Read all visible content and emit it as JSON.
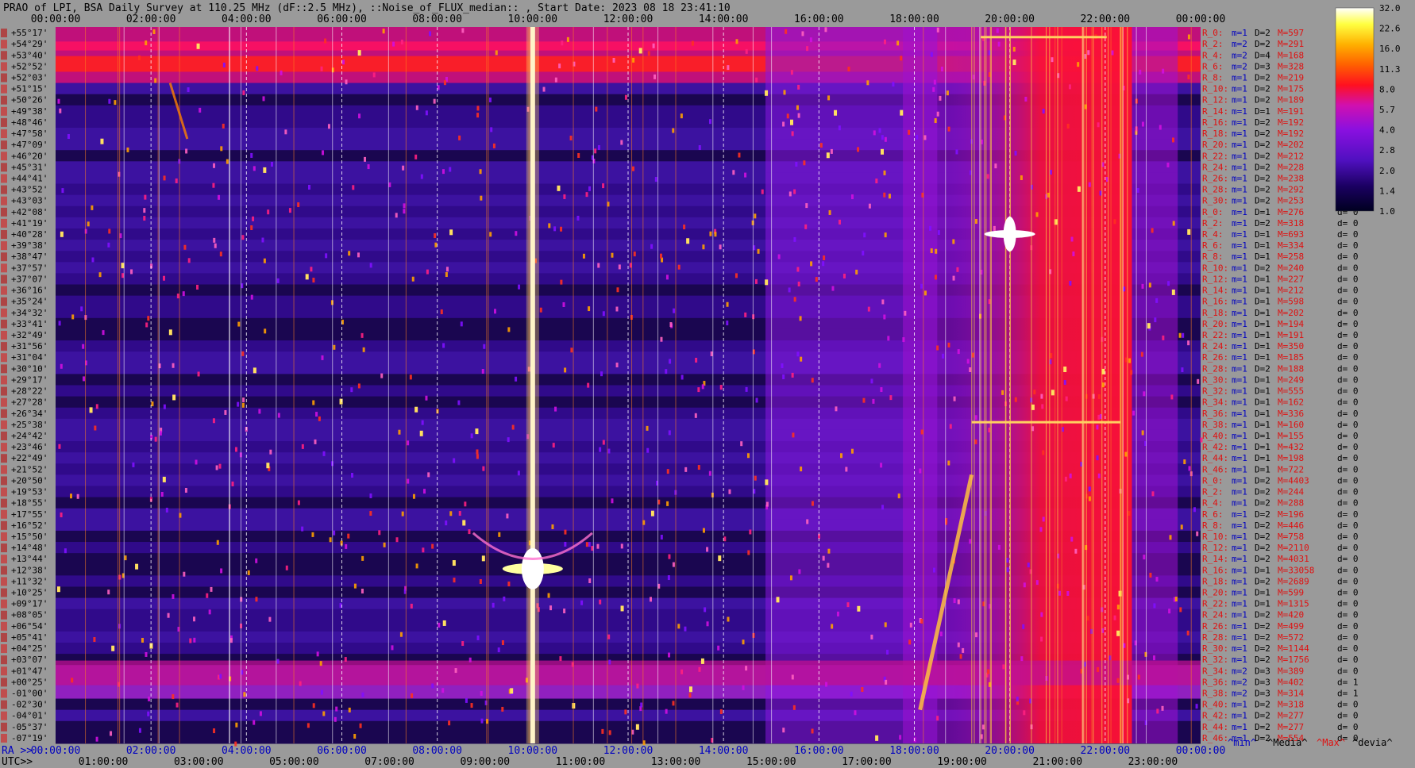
{
  "title": "PRAO of LPI, BSA Daily Survey at 110.25 MHz (dF::2.5 MHz), ::Noise_of_FLUX_median:: , Start Date: 2023 08 18 23:41:10",
  "ra_prefix": "RA >>",
  "utc_prefix": "UTC>>",
  "colorbar": {
    "ticks": [
      "32.0",
      "22.6",
      "16.0",
      "11.3",
      "8.0",
      "5.7",
      "4.0",
      "2.8",
      "2.0",
      "1.4",
      "1.0"
    ]
  },
  "chart_data": {
    "type": "heatmap",
    "title": "PRAO of LPI, BSA Daily Survey at 110.25 MHz (dF::2.5 MHz), ::Noise_of_FLUX_median:: , Start Date: 2023 08 18 23:41:10",
    "x_top_ticks": [
      "00:00:00",
      "02:00:00",
      "04:00:00",
      "06:00:00",
      "08:00:00",
      "10:00:00",
      "12:00:00",
      "14:00:00",
      "16:00:00",
      "18:00:00",
      "20:00:00",
      "22:00:00",
      "00:00:00"
    ],
    "x_ra_ticks": [
      "00:00:00",
      "02:00:00",
      "04:00:00",
      "06:00:00",
      "08:00:00",
      "10:00:00",
      "12:00:00",
      "14:00:00",
      "16:00:00",
      "18:00:00",
      "20:00:00",
      "22:00:00",
      "00:00:00"
    ],
    "x_utc_ticks": [
      "01:00:00",
      "03:00:00",
      "05:00:00",
      "07:00:00",
      "09:00:00",
      "11:00:00",
      "13:00:00",
      "15:00:00",
      "17:00:00",
      "19:00:00",
      "21:00:00",
      "23:00:00"
    ],
    "y_ticks": [
      "+55°17'",
      "+54°29'",
      "+53°40'",
      "+52°52'",
      "+52°03'",
      "+51°15'",
      "+50°26'",
      "+49°38'",
      "+48°46'",
      "+47°58'",
      "+47°09'",
      "+46°20'",
      "+45°31'",
      "+44°41'",
      "+43°52'",
      "+43°03'",
      "+42°08'",
      "+41°19'",
      "+40°28'",
      "+39°38'",
      "+38°47'",
      "+37°57'",
      "+37°07'",
      "+36°16'",
      "+35°24'",
      "+34°32'",
      "+33°41'",
      "+32°49'",
      "+31°56'",
      "+31°04'",
      "+30°10'",
      "+29°17'",
      "+28°22'",
      "+27°28'",
      "+26°34'",
      "+25°38'",
      "+24°42'",
      "+23°46'",
      "+22°49'",
      "+21°52'",
      "+20°50'",
      "+19°53'",
      "+18°55'",
      "+17°55'",
      "+16°52'",
      "+15°50'",
      "+14°48'",
      "+13°44'",
      "+12°38'",
      "+11°32'",
      "+10°25'",
      "+09°17'",
      "+08°05'",
      "+06°54'",
      "+05°41'",
      "+04°25'",
      "+03°07'",
      "+01°47'",
      "+00°25'",
      "-01°00'",
      "-02°30'",
      "-04°01'",
      "-05°37'",
      "-07°19'"
    ],
    "colorbar_range": [
      1.0,
      32.0
    ],
    "colorbar_scale": "log"
  },
  "right_panel": {
    "rows": [
      {
        "r": "R_0:",
        "m": "m=1",
        "d": "D=2",
        "M": "M=597",
        "dv": "d= 0"
      },
      {
        "r": "R_2:",
        "m": "m=2",
        "d": "D=2",
        "M": "M=291",
        "dv": "d= 0"
      },
      {
        "r": "R_4:",
        "m": "m=2",
        "d": "D=4",
        "M": "M=168",
        "dv": "d= 1"
      },
      {
        "r": "R_6:",
        "m": "m=2",
        "d": "D=3",
        "M": "M=328",
        "dv": "d= 0"
      },
      {
        "r": "R_8:",
        "m": "m=1",
        "d": "D=2",
        "M": "M=219",
        "dv": "d= 0"
      },
      {
        "r": "R_10:",
        "m": "m=1",
        "d": "D=2",
        "M": "M=175",
        "dv": "d="
      },
      {
        "r": "R_12:",
        "m": "m=1",
        "d": "D=2",
        "M": "M=189",
        "dv": "d="
      },
      {
        "r": "R_14:",
        "m": "m=1",
        "d": "D=1",
        "M": "M=191",
        "dv": "d="
      },
      {
        "r": "R_16:",
        "m": "m=1",
        "d": "D=2",
        "M": "M=192",
        "dv": "d="
      },
      {
        "r": "R_18:",
        "m": "m=1",
        "d": "D=2",
        "M": "M=192",
        "dv": "d="
      },
      {
        "r": "R_20:",
        "m": "m=1",
        "d": "D=2",
        "M": "M=202",
        "dv": "d="
      },
      {
        "r": "R_22:",
        "m": "m=1",
        "d": "D=2",
        "M": "M=212",
        "dv": "d="
      },
      {
        "r": "R_24:",
        "m": "m=1",
        "d": "D=2",
        "M": "M=228",
        "dv": "d="
      },
      {
        "r": "R_26:",
        "m": "m=1",
        "d": "D=2",
        "M": "M=238",
        "dv": "d="
      },
      {
        "r": "R_28:",
        "m": "m=1",
        "d": "D=2",
        "M": "M=292",
        "dv": "d="
      },
      {
        "r": "R_30:",
        "m": "m=1",
        "d": "D=2",
        "M": "M=253",
        "dv": "d="
      },
      {
        "r": "R_0:",
        "m": "m=1",
        "d": "D=1",
        "M": "M=276",
        "dv": "d= 0"
      },
      {
        "r": "R_2:",
        "m": "m=1",
        "d": "D=2",
        "M": "M=318",
        "dv": "d= 0"
      },
      {
        "r": "R_4:",
        "m": "m=1",
        "d": "D=1",
        "M": "M=693",
        "dv": "d= 0"
      },
      {
        "r": "R_6:",
        "m": "m=1",
        "d": "D=1",
        "M": "M=334",
        "dv": "d= 0"
      },
      {
        "r": "R_8:",
        "m": "m=1",
        "d": "D=1",
        "M": "M=258",
        "dv": "d= 0"
      },
      {
        "r": "R_10:",
        "m": "m=1",
        "d": "D=2",
        "M": "M=240",
        "dv": "d= 0"
      },
      {
        "r": "R_12:",
        "m": "m=1",
        "d": "D=1",
        "M": "M=227",
        "dv": "d= 0"
      },
      {
        "r": "R_14:",
        "m": "m=1",
        "d": "D=1",
        "M": "M=212",
        "dv": "d= 0"
      },
      {
        "r": "R_16:",
        "m": "m=1",
        "d": "D=1",
        "M": "M=598",
        "dv": "d= 0"
      },
      {
        "r": "R_18:",
        "m": "m=1",
        "d": "D=1",
        "M": "M=202",
        "dv": "d= 0"
      },
      {
        "r": "R_20:",
        "m": "m=1",
        "d": "D=1",
        "M": "M=194",
        "dv": "d= 0"
      },
      {
        "r": "R_22:",
        "m": "m=1",
        "d": "D=1",
        "M": "M=191",
        "dv": "d= 0"
      },
      {
        "r": "R_24:",
        "m": "m=1",
        "d": "D=1",
        "M": "M=350",
        "dv": "d= 0"
      },
      {
        "r": "R_26:",
        "m": "m=1",
        "d": "D=1",
        "M": "M=185",
        "dv": "d= 0"
      },
      {
        "r": "R_28:",
        "m": "m=1",
        "d": "D=2",
        "M": "M=188",
        "dv": "d= 0"
      },
      {
        "r": "R_30:",
        "m": "m=1",
        "d": "D=1",
        "M": "M=249",
        "dv": "d= 0"
      },
      {
        "r": "R_32:",
        "m": "m=1",
        "d": "D=1",
        "M": "M=555",
        "dv": "d= 0"
      },
      {
        "r": "R_34:",
        "m": "m=1",
        "d": "D=1",
        "M": "M=162",
        "dv": "d= 0"
      },
      {
        "r": "R_36:",
        "m": "m=1",
        "d": "D=1",
        "M": "M=336",
        "dv": "d= 0"
      },
      {
        "r": "R_38:",
        "m": "m=1",
        "d": "D=1",
        "M": "M=160",
        "dv": "d= 0"
      },
      {
        "r": "R_40:",
        "m": "m=1",
        "d": "D=1",
        "M": "M=155",
        "dv": "d= 0"
      },
      {
        "r": "R_42:",
        "m": "m=1",
        "d": "D=1",
        "M": "M=432",
        "dv": "d= 0"
      },
      {
        "r": "R_44:",
        "m": "m=1",
        "d": "D=1",
        "M": "M=198",
        "dv": "d= 0"
      },
      {
        "r": "R_46:",
        "m": "m=1",
        "d": "D=1",
        "M": "M=722",
        "dv": "d= 0"
      },
      {
        "r": "R_0:",
        "m": "m=1",
        "d": "D=2",
        "M": "M=4403",
        "dv": "d= 0"
      },
      {
        "r": "R_2:",
        "m": "m=1",
        "d": "D=2",
        "M": "M=244",
        "dv": "d= 0"
      },
      {
        "r": "R_4:",
        "m": "m=1",
        "d": "D=2",
        "M": "M=288",
        "dv": "d= 0"
      },
      {
        "r": "R_6:",
        "m": "m=1",
        "d": "D=2",
        "M": "M=196",
        "dv": "d= 0"
      },
      {
        "r": "R_8:",
        "m": "m=1",
        "d": "D=2",
        "M": "M=446",
        "dv": "d= 0"
      },
      {
        "r": "R_10:",
        "m": "m=1",
        "d": "D=2",
        "M": "M=758",
        "dv": "d= 0"
      },
      {
        "r": "R_12:",
        "m": "m=1",
        "d": "D=2",
        "M": "M=2110",
        "dv": "d= 0"
      },
      {
        "r": "R_14:",
        "m": "m=1",
        "d": "D=2",
        "M": "M=4031",
        "dv": "d= 0"
      },
      {
        "r": "R_16:",
        "m": "m=1",
        "d": "D=1",
        "M": "M=33058",
        "dv": "d= 0"
      },
      {
        "r": "R_18:",
        "m": "m=1",
        "d": "D=2",
        "M": "M=2689",
        "dv": "d= 0"
      },
      {
        "r": "R_20:",
        "m": "m=1",
        "d": "D=1",
        "M": "M=599",
        "dv": "d= 0"
      },
      {
        "r": "R_22:",
        "m": "m=1",
        "d": "D=1",
        "M": "M=1315",
        "dv": "d= 0"
      },
      {
        "r": "R_24:",
        "m": "m=1",
        "d": "D=2",
        "M": "M=420",
        "dv": "d= 0"
      },
      {
        "r": "R_26:",
        "m": "m=1",
        "d": "D=2",
        "M": "M=499",
        "dv": "d= 0"
      },
      {
        "r": "R_28:",
        "m": "m=1",
        "d": "D=2",
        "M": "M=572",
        "dv": "d= 0"
      },
      {
        "r": "R_30:",
        "m": "m=1",
        "d": "D=2",
        "M": "M=1144",
        "dv": "d= 0"
      },
      {
        "r": "R_32:",
        "m": "m=1",
        "d": "D=2",
        "M": "M=1756",
        "dv": "d= 0"
      },
      {
        "r": "R_34:",
        "m": "m=2",
        "d": "D=3",
        "M": "M=389",
        "dv": "d= 0"
      },
      {
        "r": "R_36:",
        "m": "m=2",
        "d": "D=3",
        "M": "M=402",
        "dv": "d= 1"
      },
      {
        "r": "R_38:",
        "m": "m=2",
        "d": "D=3",
        "M": "M=314",
        "dv": "d= 1"
      },
      {
        "r": "R_40:",
        "m": "m=1",
        "d": "D=2",
        "M": "M=318",
        "dv": "d= 0"
      },
      {
        "r": "R_42:",
        "m": "m=1",
        "d": "D=2",
        "M": "M=277",
        "dv": "d= 0"
      },
      {
        "r": "R_44:",
        "m": "m=1",
        "d": "D=2",
        "M": "M=277",
        "dv": "d= 0"
      },
      {
        "r": "R_46:",
        "m": "m=1",
        "d": "D=2",
        "M": "M=554",
        "dv": "d= 0"
      }
    ],
    "legend": {
      "min": "^min^",
      "median": "^Media^",
      "max": "^Max^",
      "dev": "^devia^"
    }
  },
  "colors": {
    "background": "#9a9a9a",
    "label_red": "#e01010",
    "label_blue": "#0000c0",
    "text": "#000000"
  }
}
